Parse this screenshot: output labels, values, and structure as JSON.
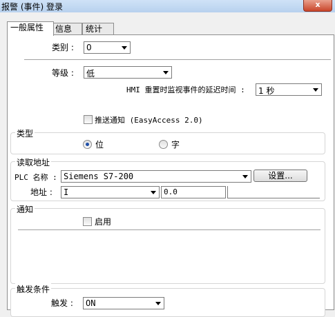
{
  "window": {
    "title": "报警 (事件) 登录",
    "close_label": "x"
  },
  "tabs": [
    {
      "label": "一般属性"
    },
    {
      "label": "信息"
    },
    {
      "label": "统计"
    }
  ],
  "general": {
    "category_label": "类别 :",
    "category_value": "0",
    "level_label": "等级 :",
    "level_value": "低",
    "hmi_delay_label": "HMI 重置时监视事件的延迟时间 :",
    "hmi_delay_value": "1 秒",
    "push_label": "推送通知 (EasyAccess 2.0)"
  },
  "type_group": {
    "title": "类型",
    "bit_label": "位",
    "word_label": "字",
    "selected": "位"
  },
  "read_address": {
    "title": "读取地址",
    "plc_label": "PLC 名称 :",
    "plc_value": "Siemens S7-200",
    "settings_button": "设置...",
    "address_label": "地址 :",
    "address_type": "I",
    "address_value": "0.0"
  },
  "notify": {
    "title": "通知",
    "enable_label": "启用"
  },
  "trigger": {
    "title": "触发条件",
    "label": "触发 :",
    "value": "ON"
  }
}
